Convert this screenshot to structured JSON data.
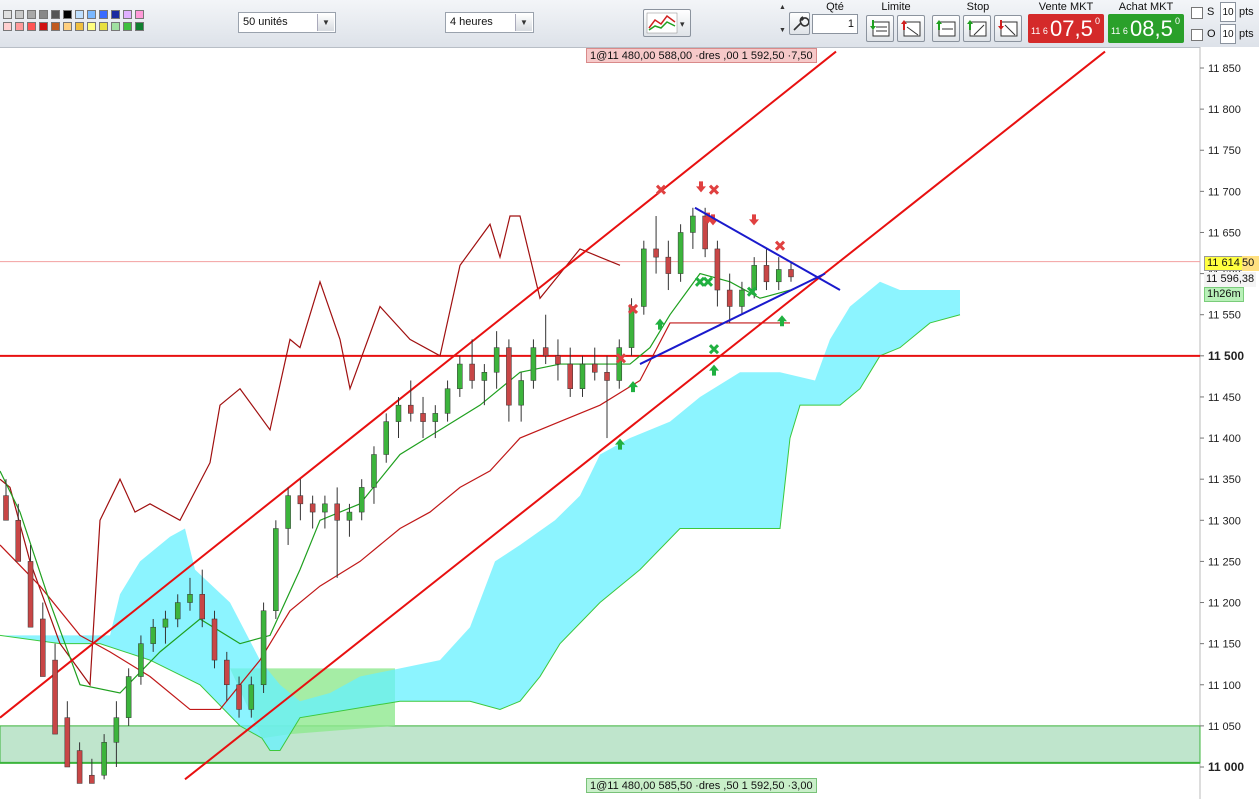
{
  "toolbar": {
    "swatch_colors": [
      "#e0e0e0",
      "#c8c8c8",
      "#a8a8a8",
      "#888888",
      "#555555",
      "#000000",
      "#bfe0ff",
      "#7ab8ff",
      "#3a6bff",
      "#1a2aa0",
      "#e0b0ff",
      "#ff9ad8",
      "#ffd0d0",
      "#ff9a9a",
      "#ff5555",
      "#d01010",
      "#c05a20",
      "#ffd080",
      "#f0c040",
      "#ffff80",
      "#e8e040",
      "#a0e0a0",
      "#40c040",
      "#108030"
    ],
    "units_select": "50 unités",
    "period_select": "4 heures",
    "qty_label": "Qté",
    "qty_value": "1",
    "limit_label": "Limite",
    "stop_label": "Stop",
    "sell_label": "Vente MKT",
    "sell_small": "11 6",
    "sell_big": "07,5",
    "sell_sup": "0",
    "buy_label": "Achat MKT",
    "buy_small": "11 6",
    "buy_big": "08,5",
    "buy_sup": "0",
    "s_label": "S",
    "o_label": "O",
    "s_pts_value": "10",
    "o_pts_value": "10",
    "pts_label": "pts",
    "colors": {
      "sell_bg": "#d42a2a",
      "buy_bg": "#2aa02a"
    }
  },
  "chart": {
    "top_tag": [
      "1@11 480,00",
      "588,00",
      "·dres",
      ",00",
      "1 592,50",
      "·7,50"
    ],
    "bottom_tag": [
      "1@11 480,00",
      "585,50",
      "·dres",
      ",50",
      "1 592,50",
      "·3,00"
    ],
    "axis_labels": [
      "11 850",
      "11 800",
      "11 750",
      "11 700",
      "11 650",
      "11 600",
      "11 550",
      "11 500",
      "11 450",
      "11 400",
      "11 350",
      "11 300",
      "11 250",
      "11 200",
      "11 150",
      "11 100",
      "11 050",
      "11 000"
    ],
    "axis_bold": [
      "11 500",
      "11 000"
    ],
    "last_price_box": "11 614",
    "last_price_suffix": "50",
    "current_price": "11 596,38",
    "timer": "1h26m",
    "colors": {
      "bull": "#3cb43c",
      "bear": "#c84646",
      "cloud": "#66f0ff",
      "channel": "#e81010",
      "triangle": "#1a1acc"
    }
  },
  "chart_data": {
    "type": "candlestick",
    "y_axis_ticks": [
      11850,
      11800,
      11750,
      11700,
      11650,
      11600,
      11550,
      11500,
      11450,
      11400,
      11350,
      11300,
      11250,
      11200,
      11150,
      11100,
      11050,
      11000
    ],
    "ylim": [
      10985,
      11880
    ],
    "horizontal_lines": [
      11500,
      11005
    ],
    "current_price": 11596.38,
    "last_price": 11614.5,
    "zone_range": [
      11005,
      11050
    ],
    "series": [
      {
        "name": "candles",
        "values": [
          [
            11330,
            11350,
            11320,
            11300
          ],
          [
            11300,
            11320,
            11260,
            11250
          ],
          [
            11250,
            11270,
            11180,
            11170
          ],
          [
            11180,
            11200,
            11130,
            11110
          ],
          [
            11130,
            11150,
            11060,
            11040
          ],
          [
            11060,
            11080,
            11020,
            11000
          ],
          [
            11020,
            11030,
            10990,
            10980
          ],
          [
            10990,
            11010,
            10985,
            10980
          ],
          [
            10990,
            11040,
            10985,
            11030
          ],
          [
            11030,
            11080,
            11000,
            11060
          ],
          [
            11060,
            11120,
            11050,
            11110
          ],
          [
            11110,
            11160,
            11100,
            11150
          ],
          [
            11150,
            11180,
            11140,
            11170
          ],
          [
            11170,
            11190,
            11150,
            11180
          ],
          [
            11180,
            11210,
            11170,
            11200
          ],
          [
            11200,
            11230,
            11190,
            11210
          ],
          [
            11210,
            11240,
            11170,
            11180
          ],
          [
            11180,
            11190,
            11120,
            11130
          ],
          [
            11130,
            11140,
            11080,
            11100
          ],
          [
            11100,
            11110,
            11060,
            11070
          ],
          [
            11070,
            11110,
            11060,
            11100
          ],
          [
            11100,
            11200,
            11090,
            11190
          ],
          [
            11190,
            11300,
            11180,
            11290
          ],
          [
            11290,
            11340,
            11270,
            11330
          ],
          [
            11330,
            11350,
            11300,
            11320
          ],
          [
            11320,
            11330,
            11290,
            11310
          ],
          [
            11310,
            11330,
            11290,
            11320
          ],
          [
            11320,
            11340,
            11230,
            11300
          ],
          [
            11300,
            11320,
            11280,
            11310
          ],
          [
            11310,
            11350,
            11300,
            11340
          ],
          [
            11340,
            11390,
            11320,
            11380
          ],
          [
            11380,
            11430,
            11370,
            11420
          ],
          [
            11420,
            11450,
            11400,
            11440
          ],
          [
            11440,
            11470,
            11420,
            11430
          ],
          [
            11430,
            11450,
            11400,
            11420
          ],
          [
            11420,
            11440,
            11400,
            11430
          ],
          [
            11430,
            11470,
            11420,
            11460
          ],
          [
            11460,
            11500,
            11450,
            11490
          ],
          [
            11490,
            11520,
            11460,
            11470
          ],
          [
            11470,
            11490,
            11440,
            11480
          ],
          [
            11480,
            11530,
            11460,
            11510
          ],
          [
            11510,
            11520,
            11420,
            11440
          ],
          [
            11440,
            11480,
            11420,
            11470
          ],
          [
            11470,
            11520,
            11460,
            11510
          ],
          [
            11510,
            11550,
            11490,
            11500
          ],
          [
            11500,
            11520,
            11470,
            11490
          ],
          [
            11490,
            11510,
            11450,
            11460
          ],
          [
            11460,
            11500,
            11450,
            11490
          ],
          [
            11490,
            11510,
            11470,
            11480
          ],
          [
            11480,
            11500,
            11400,
            11470
          ],
          [
            11470,
            11520,
            11460,
            11510
          ],
          [
            11510,
            11570,
            11500,
            11560
          ],
          [
            11560,
            11640,
            11550,
            11630
          ],
          [
            11630,
            11670,
            11600,
            11620
          ],
          [
            11620,
            11640,
            11580,
            11600
          ],
          [
            11600,
            11660,
            11590,
            11650
          ],
          [
            11650,
            11680,
            11630,
            11670
          ],
          [
            11670,
            11680,
            11620,
            11630
          ],
          [
            11630,
            11640,
            11560,
            11580
          ],
          [
            11580,
            11600,
            11540,
            11560
          ],
          [
            11560,
            11590,
            11550,
            11580
          ],
          [
            11580,
            11620,
            11570,
            11610
          ],
          [
            11610,
            11630,
            11580,
            11590
          ],
          [
            11590,
            11620,
            11580,
            11605
          ],
          [
            11605,
            11615,
            11590,
            11596
          ]
        ]
      }
    ]
  }
}
